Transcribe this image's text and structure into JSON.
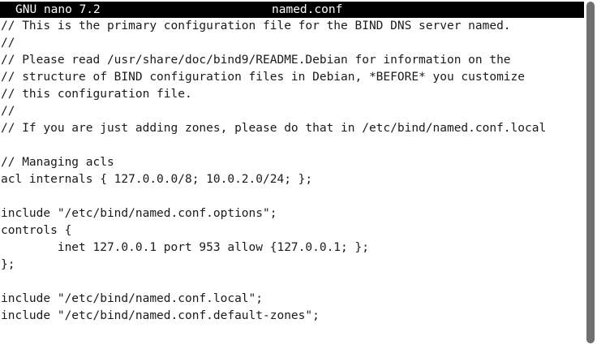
{
  "titlebar": {
    "app_name": "GNU nano 7.2",
    "file_name": "named.conf"
  },
  "editor": {
    "lines": [
      "// This is the primary configuration file for the BIND DNS server named.",
      "//",
      "// Please read /usr/share/doc/bind9/README.Debian for information on the",
      "// structure of BIND configuration files in Debian, *BEFORE* you customize",
      "// this configuration file.",
      "//",
      "// If you are just adding zones, please do that in /etc/bind/named.conf.local",
      "",
      "// Managing acls",
      "acl internals { 127.0.0.0/8; 10.0.2.0/24; };",
      "",
      "include \"/etc/bind/named.conf.options\";",
      "controls {",
      "        inet 127.0.0.1 port 953 allow {127.0.0.1; };",
      "};",
      "",
      "include \"/etc/bind/named.conf.local\";",
      "include \"/etc/bind/named.conf.default-zones\";",
      ""
    ]
  },
  "colors": {
    "titlebar_bg": "#000000",
    "titlebar_fg": "#ffffff",
    "editor_bg": "#ffffff",
    "editor_fg": "#1a1a1a",
    "scrollbar_thumb": "#6f6f6f"
  }
}
